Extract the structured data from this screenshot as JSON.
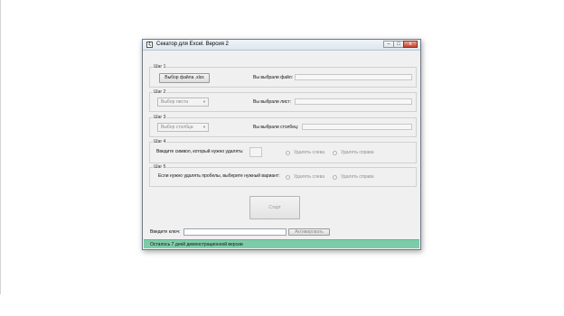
{
  "window": {
    "title": "Секатор для Excel. Версия 2",
    "icon_glyph": "ξ",
    "minimize_glyph": "–",
    "maximize_glyph": "□",
    "close_glyph": "x"
  },
  "steps": {
    "step1": {
      "legend": "Шаг 1",
      "button_label": "Выбор файла .xlsx",
      "result_label": "Вы выбрали файл:",
      "result_value": ""
    },
    "step2": {
      "legend": "Шаг 2",
      "combo_value": "Выбор листа",
      "result_label": "Вы выбрали лист:",
      "result_value": ""
    },
    "step3": {
      "legend": "Шаг 3",
      "combo_value": "Выбор столбца",
      "result_label": "Вы выбрали столбец:",
      "result_value": ""
    },
    "step4": {
      "legend": "Шаг 4",
      "prompt": "Введите символ, который нужно удалять:",
      "symbol_value": "",
      "option_left": "Удалять слева",
      "option_right": "Удалять справа"
    },
    "step5": {
      "legend": "Шаг 5",
      "prompt": "Если нужно удалять пробелы, выберите нужный вариант:",
      "option_left": "Удалять слева",
      "option_right": "Удалять справа"
    }
  },
  "start_button": "Старт",
  "license": {
    "key_label": "Введите ключ:",
    "key_value": "",
    "activate_button": "Активировать"
  },
  "status_bar": {
    "text": "Осталось 7 дней демонстрационной версии",
    "color": "#7dcba8"
  }
}
